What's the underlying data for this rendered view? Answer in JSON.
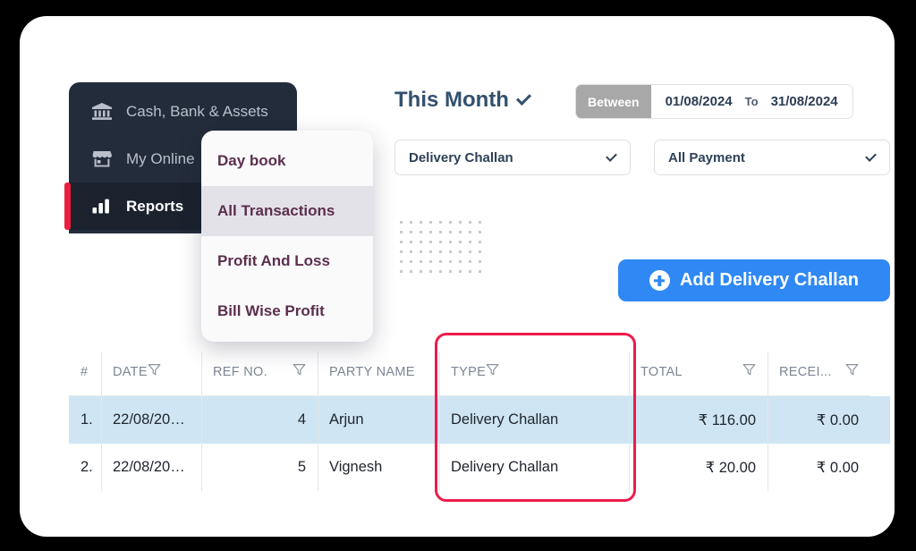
{
  "sidebar": {
    "items": [
      {
        "label": "Cash, Bank & Assets",
        "icon": "bank-icon",
        "active": false
      },
      {
        "label": "My Online",
        "icon": "store-icon",
        "active": false
      },
      {
        "label": "Reports",
        "icon": "bar-chart-icon",
        "active": true
      }
    ]
  },
  "flyout": {
    "items": [
      {
        "label": "Day book",
        "selected": false
      },
      {
        "label": "All Transactions",
        "selected": true
      },
      {
        "label": "Profit And Loss",
        "selected": false
      },
      {
        "label": "Bill Wise Profit",
        "selected": false
      }
    ]
  },
  "header": {
    "period_label": "This Month",
    "between_label": "Between",
    "date_from": "01/08/2024",
    "date_to_label": "To",
    "date_to": "31/08/2024"
  },
  "filters": {
    "voucher_type": "Delivery Challan",
    "payment_type": "All Payment"
  },
  "actions": {
    "add_label": "Add Delivery Challan"
  },
  "table": {
    "columns": [
      {
        "key": "num",
        "label": "#",
        "filter": false
      },
      {
        "key": "date",
        "label": "DATE",
        "filter": true
      },
      {
        "key": "ref",
        "label": "REF NO.",
        "filter": true
      },
      {
        "key": "party",
        "label": "PARTY NAME",
        "filter": false
      },
      {
        "key": "type",
        "label": "TYPE",
        "filter": true
      },
      {
        "key": "total",
        "label": "TOTAL",
        "filter": true
      },
      {
        "key": "recv",
        "label": "RECEI...",
        "filter": true
      }
    ],
    "rows": [
      {
        "num": "1.",
        "date": "22/08/20…",
        "ref": "4",
        "party": "Arjun",
        "type": "Delivery Challan",
        "total": "₹ 116.00",
        "recv": "₹ 0.00",
        "highlighted": true
      },
      {
        "num": "2.",
        "date": "22/08/20…",
        "ref": "5",
        "party": "Vignesh",
        "type": "Delivery Challan",
        "total": "₹ 20.00",
        "recv": "₹ 0.00",
        "highlighted": false
      }
    ]
  },
  "colors": {
    "page_background": "#000000",
    "card": "#ffffff",
    "sidebar": "#232c3b",
    "sidebar_active": "#1b222e",
    "accent_red": "#ea1f40",
    "primary_blue": "#2f88f3",
    "row_highlight": "#cfe5f3",
    "menu_text": "#5b2f4c",
    "heading_blue": "#33506e",
    "annotation_red": "#ed1b4c"
  }
}
